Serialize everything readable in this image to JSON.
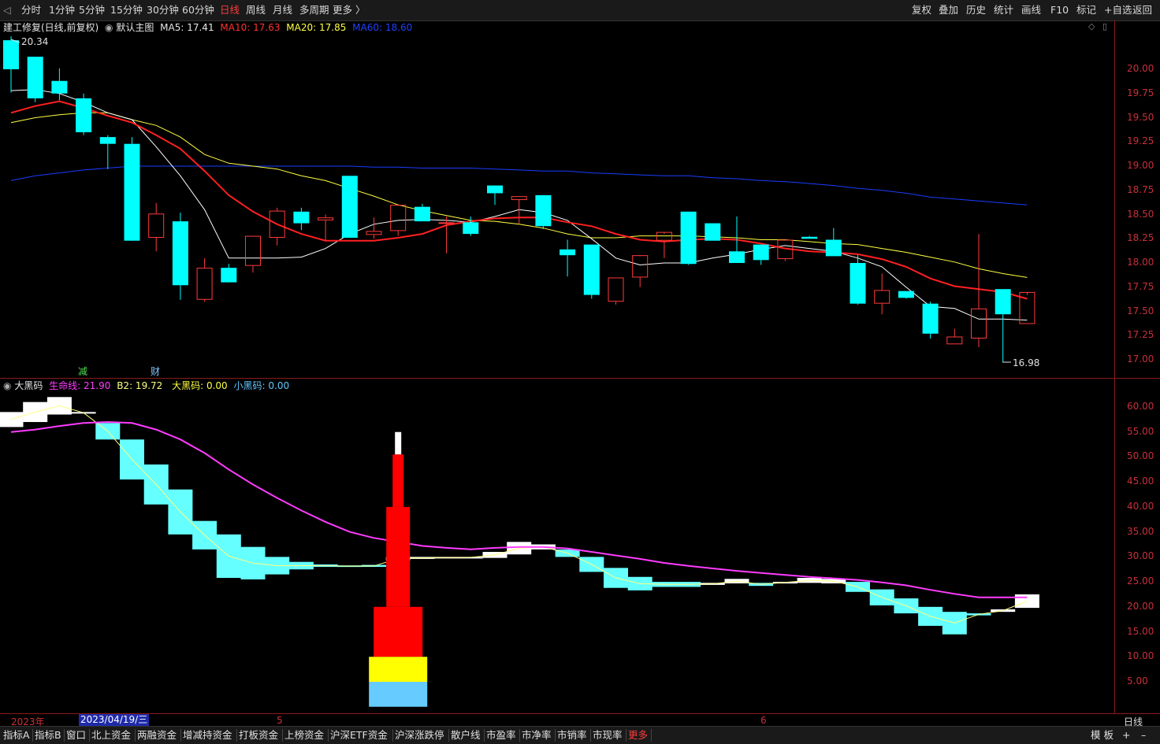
{
  "toolbar": {
    "periods": [
      "分时",
      "1分钟",
      "5分钟",
      "15分钟",
      "30分钟",
      "60分钟",
      "日线",
      "周线",
      "月线",
      "多周期",
      "更多 〉"
    ],
    "active_period": "日线",
    "right_tools": [
      "复权",
      "叠加",
      "历史",
      "统计",
      "画线",
      "F10",
      "标记",
      "+自选",
      "返回"
    ]
  },
  "main_chart": {
    "title": "建工修复(日线,前复权)",
    "indicator": "默认主图",
    "ma5": "MA5: 17.41",
    "ma10": "MA10: 17.63",
    "ma20": "MA20: 17.85",
    "ma60": "MA60: 18.60",
    "high_label": "20.34",
    "low_label": "16.98",
    "event_markers": [
      "减",
      "财"
    ],
    "y_ticks": [
      "20.00",
      "19.75",
      "19.50",
      "19.25",
      "19.00",
      "18.75",
      "18.50",
      "18.25",
      "18.00",
      "17.75",
      "17.50",
      "17.25",
      "17.00"
    ]
  },
  "sub_chart": {
    "title": "大黑码",
    "lifeline": "生命线: 21.90",
    "b2": "B2: 19.72",
    "big_black": "大黑码: 0.00",
    "small_black": "小黑码: 0.00",
    "y_ticks": [
      "60.00",
      "55.00",
      "50.00",
      "45.00",
      "40.00",
      "35.00",
      "30.00",
      "25.00",
      "20.00",
      "15.00",
      "10.00",
      "5.00"
    ]
  },
  "date_axis": {
    "labels": [
      "2023年",
      "5",
      "6"
    ],
    "cursor_date": "2023/04/19/三",
    "period_label": "日线"
  },
  "bottom_bar": {
    "tabs": [
      "指标A",
      "指标B",
      "窗口",
      "北上资金",
      "两融资金",
      "增减持资金",
      "打板资金",
      "上榜资金",
      "沪深ETF资金",
      "沪深涨跌停",
      "散户线",
      "市盈率",
      "市净率",
      "市销率",
      "市现率",
      "更多"
    ],
    "right": [
      "模 板",
      "+",
      "–"
    ]
  },
  "colors": {
    "up": "#ff3b3b",
    "down": "#00ffff",
    "ma5": "#ffffff",
    "ma10": "#ff2020",
    "ma20": "#ffff40",
    "ma60": "#1a3cff",
    "lifeline": "#ff3cff",
    "axis": "#8b1a1a"
  },
  "chart_data": {
    "type": "candlestick",
    "dates_note_axis": [
      "2023年",
      "5",
      "6"
    ],
    "ohlc": [
      [
        20.3,
        20.34,
        19.76,
        20.0
      ],
      [
        20.13,
        20.13,
        19.66,
        19.7
      ],
      [
        19.88,
        20.01,
        19.68,
        19.75
      ],
      [
        19.7,
        19.75,
        19.32,
        19.35
      ],
      [
        19.3,
        19.32,
        18.97,
        19.23
      ],
      [
        19.23,
        19.3,
        18.28,
        18.23
      ],
      [
        18.26,
        18.62,
        18.12,
        18.51
      ],
      [
        18.43,
        18.52,
        17.62,
        17.77
      ],
      [
        17.62,
        18.05,
        17.6,
        17.95
      ],
      [
        17.95,
        17.99,
        17.8,
        17.8
      ],
      [
        17.97,
        18.28,
        17.9,
        18.28
      ],
      [
        18.26,
        18.57,
        18.18,
        18.54
      ],
      [
        18.53,
        18.57,
        18.34,
        18.41
      ],
      [
        18.44,
        18.5,
        18.23,
        18.47
      ],
      [
        18.9,
        18.9,
        18.26,
        18.26
      ],
      [
        18.29,
        18.47,
        18.25,
        18.33
      ],
      [
        18.33,
        18.6,
        18.28,
        18.6
      ],
      [
        18.58,
        18.61,
        18.43,
        18.43
      ],
      [
        18.42,
        18.48,
        18.1,
        18.42
      ],
      [
        18.42,
        18.48,
        18.28,
        18.3
      ],
      [
        18.8,
        18.8,
        18.6,
        18.72
      ],
      [
        18.65,
        18.69,
        18.4,
        18.69
      ],
      [
        18.7,
        18.7,
        18.35,
        18.38
      ],
      [
        18.14,
        18.24,
        17.86,
        18.08
      ],
      [
        18.19,
        18.19,
        17.63,
        17.67
      ],
      [
        17.6,
        17.85,
        17.57,
        17.85
      ],
      [
        17.85,
        18.07,
        17.75,
        18.08
      ],
      [
        18.23,
        18.3,
        18.05,
        18.32
      ],
      [
        18.53,
        18.53,
        17.98,
        17.99
      ],
      [
        18.41,
        18.41,
        18.23,
        18.23
      ],
      [
        18.12,
        18.48,
        18.0,
        18.0
      ],
      [
        18.19,
        18.19,
        17.98,
        18.03
      ],
      [
        18.04,
        18.24,
        18.02,
        18.24
      ],
      [
        18.27,
        18.28,
        18.25,
        18.25
      ],
      [
        18.24,
        18.36,
        18.07,
        18.07
      ],
      [
        18.0,
        18.08,
        17.57,
        17.58
      ],
      [
        17.58,
        17.89,
        17.47,
        17.72
      ],
      [
        17.71,
        17.71,
        17.63,
        17.64
      ],
      [
        17.58,
        17.6,
        17.22,
        17.27
      ],
      [
        17.16,
        17.32,
        17.16,
        17.24
      ],
      [
        17.22,
        18.3,
        17.13,
        17.53
      ],
      [
        17.73,
        17.73,
        16.98,
        17.47
      ],
      [
        17.37,
        17.67,
        17.37,
        17.7
      ]
    ],
    "ma5": [
      19.78,
      19.79,
      19.75,
      19.66,
      19.55,
      19.48,
      19.2,
      18.9,
      18.55,
      18.05,
      18.05,
      18.05,
      18.06,
      18.15,
      18.3,
      18.4,
      18.44,
      18.45,
      18.44,
      18.42,
      18.48,
      18.55,
      18.52,
      18.44,
      18.25,
      18.05,
      17.98,
      18.0,
      18.0,
      18.05,
      18.09,
      18.14,
      18.18,
      18.15,
      18.12,
      18.05,
      17.96,
      17.75,
      17.55,
      17.53,
      17.42,
      17.42,
      17.41
    ],
    "ma10": [
      19.55,
      19.62,
      19.67,
      19.6,
      19.52,
      19.45,
      19.32,
      19.18,
      18.95,
      18.7,
      18.53,
      18.4,
      18.3,
      18.23,
      18.23,
      18.23,
      18.26,
      18.3,
      18.39,
      18.43,
      18.46,
      18.47,
      18.47,
      18.42,
      18.38,
      18.3,
      18.24,
      18.22,
      18.24,
      18.25,
      18.24,
      18.2,
      18.15,
      18.12,
      18.11,
      18.09,
      18.04,
      17.96,
      17.84,
      17.76,
      17.73,
      17.7,
      17.63
    ],
    "ma20": [
      19.45,
      19.5,
      19.53,
      19.55,
      19.55,
      19.48,
      19.42,
      19.3,
      19.12,
      19.03,
      19.0,
      18.97,
      18.9,
      18.85,
      18.77,
      18.69,
      18.6,
      18.54,
      18.49,
      18.44,
      18.43,
      18.4,
      18.36,
      18.3,
      18.26,
      18.26,
      18.28,
      18.28,
      18.28,
      18.27,
      18.26,
      18.24,
      18.24,
      18.22,
      18.2,
      18.19,
      18.15,
      18.11,
      18.06,
      18.01,
      17.94,
      17.89,
      17.85
    ],
    "ma60": [
      18.85,
      18.9,
      18.93,
      18.96,
      18.98,
      19.0,
      19.0,
      19.0,
      19.0,
      19.0,
      19.0,
      19.0,
      19.0,
      19.0,
      19.0,
      18.99,
      18.99,
      18.98,
      18.98,
      18.98,
      18.97,
      18.96,
      18.95,
      18.95,
      18.93,
      18.92,
      18.91,
      18.9,
      18.9,
      18.88,
      18.87,
      18.85,
      18.84,
      18.82,
      18.8,
      18.77,
      18.75,
      18.72,
      18.68,
      18.66,
      18.64,
      18.62,
      18.6
    ],
    "sub": {
      "lifeline": [
        55.0,
        55.5,
        56.2,
        56.8,
        57.0,
        56.8,
        55.5,
        53.5,
        50.8,
        47.5,
        44.5,
        41.8,
        39.3,
        37.0,
        35.0,
        33.8,
        33.0,
        32.2,
        31.8,
        31.5,
        31.8,
        32.0,
        32.0,
        31.7,
        31.0,
        30.3,
        29.6,
        28.8,
        28.2,
        27.7,
        27.2,
        26.8,
        26.4,
        26.0,
        25.7,
        25.4,
        24.9,
        24.3,
        23.4,
        22.6,
        21.9,
        21.9,
        21.9
      ],
      "b2_blocks": [
        {
          "hi": 59.0,
          "lo": 56.0,
          "c": "w"
        },
        {
          "hi": 61.0,
          "lo": 57.0,
          "c": "w"
        },
        {
          "hi": 62.0,
          "lo": 58.5,
          "c": "w"
        },
        {
          "hi": 59.0,
          "lo": 58.7,
          "c": "w"
        },
        {
          "hi": 56.8,
          "lo": 53.5,
          "c": "c"
        },
        {
          "hi": 53.5,
          "lo": 45.5,
          "c": "c"
        },
        {
          "hi": 48.5,
          "lo": 40.5,
          "c": "c"
        },
        {
          "hi": 43.5,
          "lo": 34.5,
          "c": "c"
        },
        {
          "hi": 37.2,
          "lo": 31.5,
          "c": "c"
        },
        {
          "hi": 34.5,
          "lo": 25.8,
          "c": "c"
        },
        {
          "hi": 32.0,
          "lo": 25.5,
          "c": "c"
        },
        {
          "hi": 30.0,
          "lo": 26.5,
          "c": "c"
        },
        {
          "hi": 29.0,
          "lo": 27.5,
          "c": "c"
        },
        {
          "hi": 28.5,
          "lo": 28.0,
          "c": "c"
        },
        {
          "hi": 28.3,
          "lo": 28.0,
          "c": "c"
        },
        {
          "hi": 28.4,
          "lo": 28.0,
          "c": "c"
        },
        {
          "hi": 30.0,
          "lo": 29.3,
          "c": "c"
        },
        {
          "hi": 30.0,
          "lo": 29.6,
          "c": "w"
        },
        {
          "hi": 30.0,
          "lo": 29.8,
          "c": "w"
        },
        {
          "hi": 30.0,
          "lo": 29.8,
          "c": "w"
        },
        {
          "hi": 31.0,
          "lo": 29.8,
          "c": "w"
        },
        {
          "hi": 33.0,
          "lo": 30.5,
          "c": "w"
        },
        {
          "hi": 32.5,
          "lo": 31.5,
          "c": "w"
        },
        {
          "hi": 31.5,
          "lo": 30.0,
          "c": "c"
        },
        {
          "hi": 30.0,
          "lo": 27.0,
          "c": "c"
        },
        {
          "hi": 27.8,
          "lo": 23.8,
          "c": "c"
        },
        {
          "hi": 26.0,
          "lo": 23.3,
          "c": "c"
        },
        {
          "hi": 25.0,
          "lo": 24.0,
          "c": "c"
        },
        {
          "hi": 25.0,
          "lo": 24.0,
          "c": "c"
        },
        {
          "hi": 24.8,
          "lo": 24.4,
          "c": "w"
        },
        {
          "hi": 25.6,
          "lo": 24.7,
          "c": "w"
        },
        {
          "hi": 24.8,
          "lo": 24.2,
          "c": "c"
        },
        {
          "hi": 25.0,
          "lo": 24.8,
          "c": "w"
        },
        {
          "hi": 25.8,
          "lo": 24.8,
          "c": "w"
        },
        {
          "hi": 25.6,
          "lo": 24.7,
          "c": "w"
        },
        {
          "hi": 25.0,
          "lo": 23.0,
          "c": "c"
        },
        {
          "hi": 23.5,
          "lo": 20.3,
          "c": "c"
        },
        {
          "hi": 21.7,
          "lo": 18.7,
          "c": "c"
        },
        {
          "hi": 20.0,
          "lo": 16.2,
          "c": "c"
        },
        {
          "hi": 19.0,
          "lo": 14.5,
          "c": "c"
        },
        {
          "hi": 18.7,
          "lo": 18.3,
          "c": "c"
        },
        {
          "hi": 19.5,
          "lo": 19.0,
          "c": "w"
        },
        {
          "hi": 22.5,
          "lo": 19.8,
          "c": "w"
        }
      ],
      "tower_index": 16,
      "tower": [
        {
          "hi": 55.0,
          "lo": 50.5,
          "color": "white"
        },
        {
          "hi": 50.5,
          "lo": 40.0,
          "color": "red"
        },
        {
          "hi": 40.0,
          "lo": 20.0,
          "color": "red"
        },
        {
          "hi": 20.0,
          "lo": 10.0,
          "color": "red"
        },
        {
          "hi": 10.0,
          "lo": 5.0,
          "color": "yellow"
        },
        {
          "hi": 5.0,
          "lo": 0.0,
          "color": "lightblue"
        }
      ]
    }
  }
}
